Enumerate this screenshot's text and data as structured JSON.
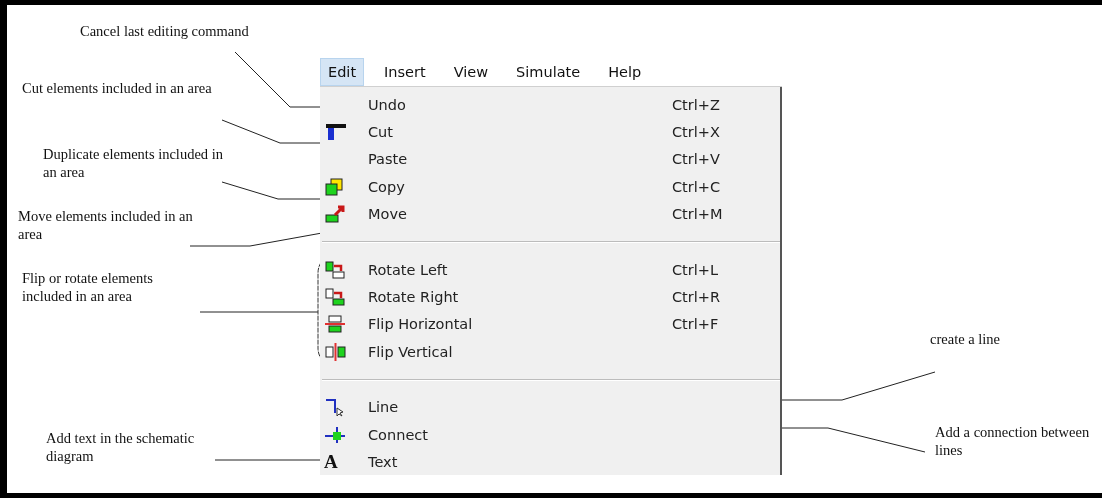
{
  "menubar": [
    {
      "label": "Edit",
      "selected": true
    },
    {
      "label": "Insert",
      "selected": false
    },
    {
      "label": "View",
      "selected": false
    },
    {
      "label": "Simulate",
      "selected": false
    },
    {
      "label": "Help",
      "selected": false
    }
  ],
  "menu": [
    {
      "kind": "command",
      "label": "Undo",
      "shortcut": "Ctrl+Z"
    },
    {
      "kind": "command",
      "label": "Cut",
      "shortcut": "Ctrl+X"
    },
    {
      "kind": "command",
      "label": "Paste",
      "shortcut": "Ctrl+V"
    },
    {
      "kind": "command",
      "label": "Copy",
      "shortcut": "Ctrl+C"
    },
    {
      "kind": "command",
      "label": "Move",
      "shortcut": "Ctrl+M"
    },
    {
      "kind": "separator"
    },
    {
      "kind": "command",
      "label": "Rotate Left",
      "shortcut": "Ctrl+L"
    },
    {
      "kind": "command",
      "label": "Rotate Right",
      "shortcut": "Ctrl+R"
    },
    {
      "kind": "command",
      "label": "Flip Horizontal",
      "shortcut": "Ctrl+F"
    },
    {
      "kind": "command",
      "label": "Flip Vertical"
    },
    {
      "kind": "separator"
    },
    {
      "kind": "command",
      "label": "Line"
    },
    {
      "kind": "command",
      "label": "Connect"
    },
    {
      "kind": "command",
      "label": "Text",
      "icon_text": "A"
    }
  ],
  "annotations": [
    {
      "text": "Cancel last editing command"
    },
    {
      "text": "Cut elements included in an area"
    },
    {
      "text": "Duplicate elements included in an area"
    },
    {
      "text": "Move elements included in an area"
    },
    {
      "text": "Flip or rotate elements included in an area"
    },
    {
      "text": "Add text in the schematic diagram"
    },
    {
      "text": "create a line"
    },
    {
      "text": "Add a connection between lines"
    }
  ]
}
